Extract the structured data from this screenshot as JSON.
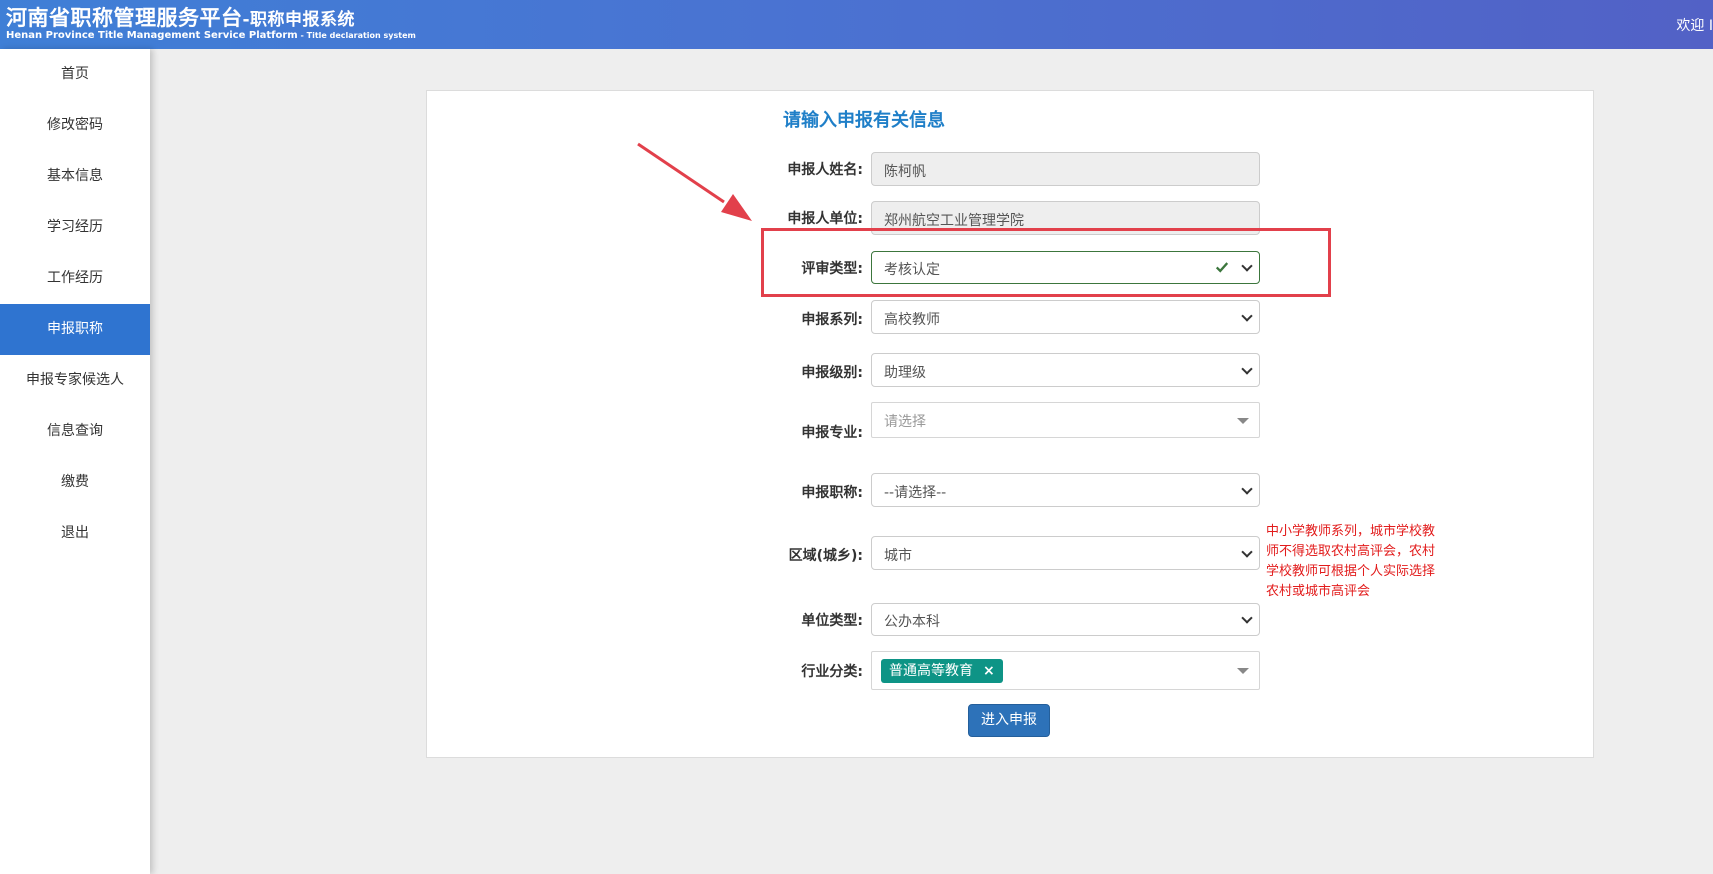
{
  "header": {
    "title_cn": "河南省职称管理服务平台",
    "title_cn_sub": "-职称申报系统",
    "title_en": "Henan Province Title Management Service Platform",
    "title_en_sub": " - Title declaration system",
    "welcome": "欢迎 I"
  },
  "sidebar": {
    "items": [
      {
        "label": "首页"
      },
      {
        "label": "修改密码"
      },
      {
        "label": "基本信息"
      },
      {
        "label": "学习经历"
      },
      {
        "label": "工作经历"
      },
      {
        "label": "申报职称",
        "active": true
      },
      {
        "label": "申报专家候选人"
      },
      {
        "label": "信息查询"
      },
      {
        "label": "缴费"
      },
      {
        "label": "退出"
      }
    ]
  },
  "form": {
    "title": "请输入申报有关信息",
    "name": {
      "label": "申报人姓名:",
      "value": "陈柯帆"
    },
    "unit": {
      "label": "申报人单位:",
      "value": "郑州航空工业管理学院"
    },
    "review_type": {
      "label": "评审类型:",
      "value": "考核认定"
    },
    "series": {
      "label": "申报系列:",
      "value": "高校教师"
    },
    "level": {
      "label": "申报级别:",
      "value": "助理级"
    },
    "major": {
      "label": "申报专业:",
      "placeholder": "请选择"
    },
    "title_select": {
      "label": "申报职称:",
      "value": "--请选择--"
    },
    "region": {
      "label": "区域(城乡):",
      "value": "城市"
    },
    "region_note": "中小学教师系列，城市学校教师不得选取农村高评会，农村学校教师可根据个人实际选择农村或城市高评会",
    "unit_type": {
      "label": "单位类型:",
      "value": "公办本科"
    },
    "industry": {
      "label": "行业分类:",
      "tag": "普通高等教育",
      "tag_remove": "×"
    },
    "submit": "进入申报"
  },
  "colors": {
    "header_start": "#3f7fd6",
    "header_end": "#5261c6",
    "active_nav": "#2f74d0",
    "form_title": "#1f7fc8",
    "tag": "#0e9486",
    "note": "#e21b1b",
    "annotation": "#e2404b",
    "valid": "#3c763d",
    "submit": "#2d72b9"
  }
}
